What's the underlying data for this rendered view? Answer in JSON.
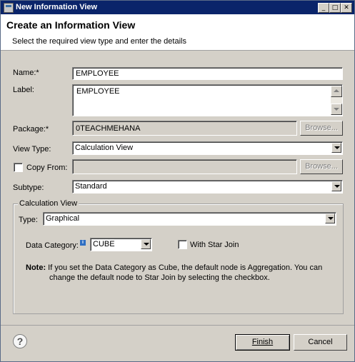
{
  "window": {
    "title": "New Information View",
    "minimize_glyph": "_",
    "maximize_glyph": "□",
    "close_glyph": "✕"
  },
  "header": {
    "title": "Create an Information View",
    "subtitle": "Select the required view type and enter the details"
  },
  "form": {
    "name_label": "Name:*",
    "name_value": "EMPLOYEE",
    "label_label": "Label:",
    "label_value": "EMPLOYEE",
    "package_label": "Package:*",
    "package_value": "0TEACHMEHANA",
    "package_browse": "Browse...",
    "view_type_label": "View Type:",
    "view_type_value": "Calculation View",
    "copy_from_label": "Copy From:",
    "copy_from_value": "",
    "copy_from_browse": "Browse...",
    "subtype_label": "Subtype:",
    "subtype_value": "Standard"
  },
  "calc_group": {
    "legend": "Calculation View",
    "type_label": "Type:",
    "type_value": "Graphical",
    "data_category_label": "Data Category:",
    "data_category_info_glyph": "i",
    "data_category_value": "CUBE",
    "star_join_label": "With Star Join",
    "note_label": "Note:",
    "note_line1": "If you set the Data Category as Cube, the default node is Aggregation. You can",
    "note_line2": "change the default node to Star Join by selecting the checkbox."
  },
  "footer": {
    "help_glyph": "?",
    "finish": "Finish",
    "cancel": "Cancel"
  },
  "colors": {
    "titlebar": "#0a246a",
    "dialog_bg": "#d4d0c8",
    "header_bg": "#ffffff"
  }
}
